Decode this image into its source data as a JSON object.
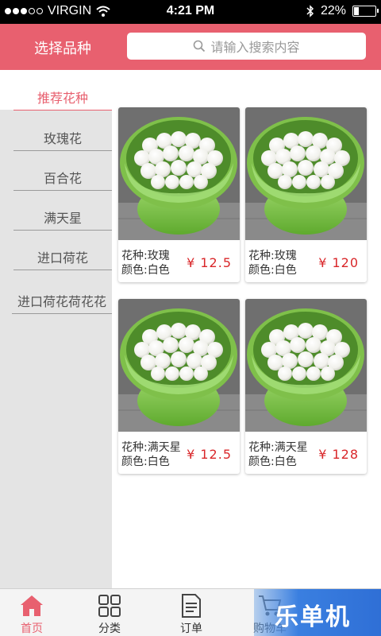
{
  "status_bar": {
    "signal_dots_filled": 3,
    "signal_dots_total": 5,
    "carrier": "VIRGIN",
    "time": "4:21 PM",
    "battery": "22%",
    "battery_level": 0.22
  },
  "header": {
    "title": "选择品种",
    "search_placeholder": "请输入搜索内容"
  },
  "sidebar": {
    "items": [
      {
        "label": "推荐花种",
        "active": true
      },
      {
        "label": "玫瑰花",
        "active": false
      },
      {
        "label": "百合花",
        "active": false
      },
      {
        "label": "满天星",
        "active": false
      },
      {
        "label": "进口荷花",
        "active": false
      },
      {
        "label": "进口荷花荷花花",
        "active": false
      }
    ]
  },
  "products": [
    {
      "variety": "花种:玫瑰",
      "color": "颜色:白色",
      "price": "¥ 12.5"
    },
    {
      "variety": "花种:玫瑰",
      "color": "颜色:白色",
      "price": "¥ 120"
    },
    {
      "variety": "花种:满天星",
      "color": "颜色:白色",
      "price": "¥ 12.5"
    },
    {
      "variety": "花种:满天星",
      "color": "颜色:白色",
      "price": "¥ 128"
    }
  ],
  "bottom_nav": {
    "items": [
      {
        "label": "首页",
        "icon": "home-icon",
        "active": true
      },
      {
        "label": "分类",
        "icon": "grid-icon",
        "active": false
      },
      {
        "label": "订单",
        "icon": "document-icon",
        "active": false
      },
      {
        "label": "购物车",
        "icon": "cart-icon",
        "active": false
      }
    ],
    "watermark": "乐单机"
  },
  "colors": {
    "accent": "#e8606f",
    "price": "#d9272a",
    "sidebar_bg": "#e4e4e4"
  }
}
